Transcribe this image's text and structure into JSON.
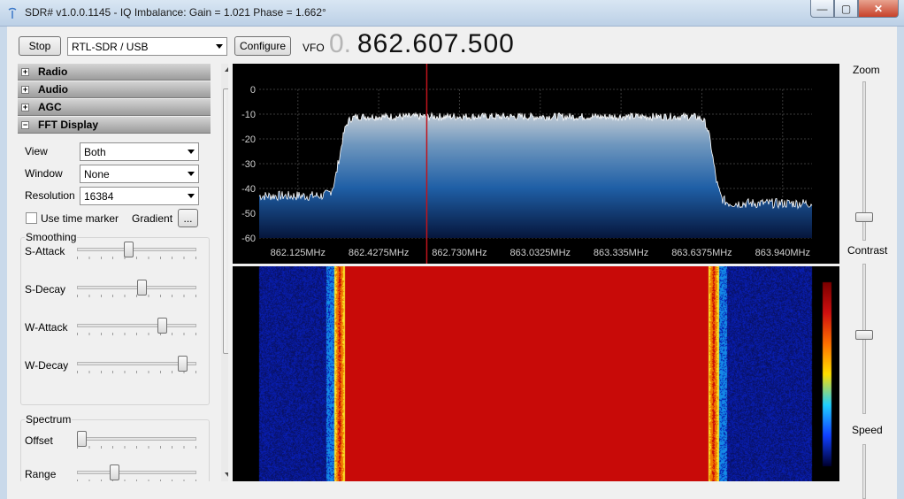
{
  "window": {
    "title": "SDR# v1.0.0.1145 - IQ Imbalance: Gain = 1.021 Phase = 1.662°",
    "minimize": "—",
    "maximize": "▢",
    "close": "✕"
  },
  "toolbar": {
    "stop_label": "Stop",
    "device": "RTL-SDR / USB",
    "configure_label": "Configure",
    "vfo_label": "VFO",
    "vfo_prefix": "0.",
    "vfo_value": "862.607.500"
  },
  "sections": {
    "radio": "Radio",
    "audio": "Audio",
    "agc": "AGC",
    "fft": "FFT Display",
    "collapsed_symbol": "+",
    "expanded_symbol": "−"
  },
  "fft": {
    "view_label": "View",
    "view_value": "Both",
    "window_label": "Window",
    "window_value": "None",
    "resolution_label": "Resolution",
    "resolution_value": "16384",
    "time_marker_label": "Use time marker",
    "gradient_label": "Gradient",
    "gradient_button": "...",
    "smoothing_group": "Smoothing",
    "sliders": [
      {
        "label": "S-Attack",
        "value": 0.43
      },
      {
        "label": "S-Decay",
        "value": 0.55
      },
      {
        "label": "W-Attack",
        "value": 0.73
      },
      {
        "label": "W-Decay",
        "value": 0.92
      }
    ],
    "spectrum_group": "Spectrum",
    "spectrum_sliders": [
      {
        "label": "Offset",
        "value": 0.0
      },
      {
        "label": "Range",
        "value": 0.3
      }
    ]
  },
  "chart_data": {
    "type": "area",
    "y_ticks": [
      "0",
      "-10",
      "-20",
      "-30",
      "-40",
      "-50",
      "-60"
    ],
    "ylim": [
      -60,
      0
    ],
    "x_ticks": [
      "862.125MHz",
      "862.4275MHz",
      "862.730MHz",
      "863.0325MHz",
      "863.335MHz",
      "863.6375MHz",
      "863.940MHz"
    ],
    "x_tick_values": [
      862.125,
      862.4275,
      862.73,
      863.0325,
      863.335,
      863.6375,
      863.94
    ],
    "xlim": [
      861.98,
      864.05
    ],
    "vfo_marker_mhz": 862.6075,
    "noise_floor_db": -45,
    "signal_top_db": -11,
    "signal_start_mhz": 862.28,
    "signal_end_mhz": 863.68,
    "grid": true
  },
  "right_panel": {
    "zoom_label": "Zoom",
    "contrast_label": "Contrast",
    "speed_label": "Speed",
    "zoom_value": 0.9,
    "contrast_value": 0.5
  },
  "colors": {
    "vfo_marker": "#c0141c",
    "spectrum_top": "#b9c8d6",
    "spectrum_bottom": "#0a2a6a"
  }
}
